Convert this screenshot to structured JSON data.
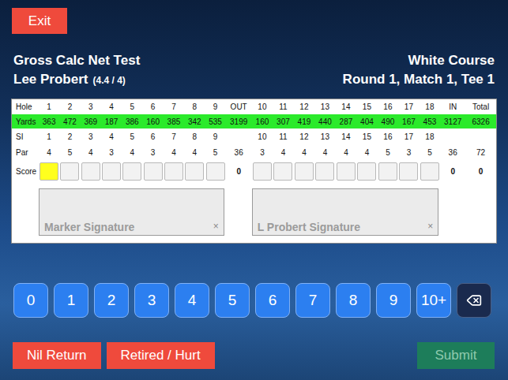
{
  "exit": "Exit",
  "header": {
    "title": "Gross Calc Net Test",
    "player": "Lee Probert",
    "handicap": "(4.4 / 4)",
    "course": "White Course",
    "round": "Round 1, Match 1, Tee 1"
  },
  "card": {
    "labels": {
      "hole": "Hole",
      "yards": "Yards",
      "si": "SI",
      "par": "Par",
      "score": "Score"
    },
    "front": [
      {
        "hole": "1",
        "yards": "363",
        "si": "1",
        "par": "4",
        "score": "",
        "selected": true
      },
      {
        "hole": "2",
        "yards": "472",
        "si": "2",
        "par": "5",
        "score": "",
        "selected": false
      },
      {
        "hole": "3",
        "yards": "369",
        "si": "3",
        "par": "4",
        "score": "",
        "selected": false
      },
      {
        "hole": "4",
        "yards": "187",
        "si": "4",
        "par": "3",
        "score": "",
        "selected": false
      },
      {
        "hole": "5",
        "yards": "386",
        "si": "5",
        "par": "4",
        "score": "",
        "selected": false
      },
      {
        "hole": "6",
        "yards": "160",
        "si": "6",
        "par": "3",
        "score": "",
        "selected": false
      },
      {
        "hole": "7",
        "yards": "385",
        "si": "7",
        "par": "4",
        "score": "",
        "selected": false
      },
      {
        "hole": "8",
        "yards": "342",
        "si": "8",
        "par": "4",
        "score": "",
        "selected": false
      },
      {
        "hole": "9",
        "yards": "535",
        "si": "9",
        "par": "5",
        "score": "",
        "selected": false
      }
    ],
    "out": {
      "hole": "OUT",
      "yards": "3199",
      "si": "",
      "par": "36",
      "score": "0"
    },
    "back": [
      {
        "hole": "10",
        "yards": "160",
        "si": "10",
        "par": "3",
        "score": "",
        "selected": false
      },
      {
        "hole": "11",
        "yards": "307",
        "si": "11",
        "par": "4",
        "score": "",
        "selected": false
      },
      {
        "hole": "12",
        "yards": "419",
        "si": "12",
        "par": "4",
        "score": "",
        "selected": false
      },
      {
        "hole": "13",
        "yards": "440",
        "si": "13",
        "par": "4",
        "score": "",
        "selected": false
      },
      {
        "hole": "14",
        "yards": "287",
        "si": "14",
        "par": "4",
        "score": "",
        "selected": false
      },
      {
        "hole": "15",
        "yards": "404",
        "si": "15",
        "par": "4",
        "score": "",
        "selected": false
      },
      {
        "hole": "16",
        "yards": "490",
        "si": "16",
        "par": "5",
        "score": "",
        "selected": false
      },
      {
        "hole": "17",
        "yards": "167",
        "si": "17",
        "par": "3",
        "score": "",
        "selected": false
      },
      {
        "hole": "18",
        "yards": "453",
        "si": "18",
        "par": "5",
        "score": "",
        "selected": false
      }
    ],
    "in": {
      "hole": "IN",
      "yards": "3127",
      "si": "",
      "par": "36",
      "score": "0"
    },
    "total": {
      "hole": "Total",
      "yards": "6326",
      "si": "",
      "par": "72",
      "score": "0"
    }
  },
  "signatures": [
    {
      "placeholder": "Marker Signature",
      "clear": "×"
    },
    {
      "placeholder": "L Probert Signature",
      "clear": "×"
    }
  ],
  "keypad": [
    "0",
    "1",
    "2",
    "3",
    "4",
    "5",
    "6",
    "7",
    "8",
    "9",
    "10+"
  ],
  "actions": [
    {
      "label": "Nil Return",
      "kind": "danger",
      "disabled": false
    },
    {
      "label": "Retired / Hurt",
      "kind": "danger",
      "disabled": false
    },
    {
      "label": "Submit",
      "kind": "submit",
      "disabled": true
    }
  ]
}
